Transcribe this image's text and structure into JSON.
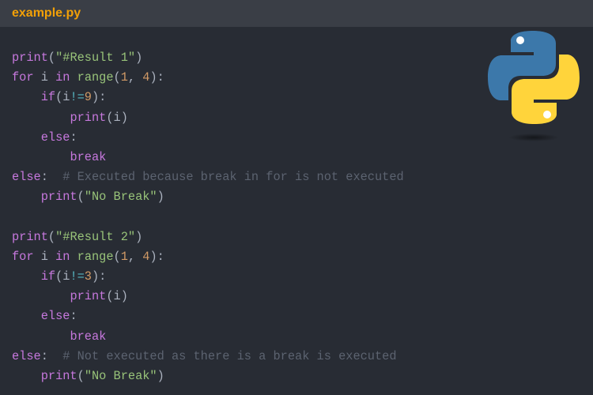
{
  "header": {
    "filename": "example.py"
  },
  "logo": {
    "name": "python-logo",
    "colors": {
      "blue": "#3c78aa",
      "yellow": "#ffd43b"
    }
  },
  "code": {
    "lines": [
      [
        [
          "fn",
          "print"
        ],
        [
          "p",
          "("
        ],
        [
          "str",
          "\"#Result 1\""
        ],
        [
          "p",
          ")"
        ]
      ],
      [
        [
          "kw",
          "for"
        ],
        [
          "p",
          " i "
        ],
        [
          "kw",
          "in"
        ],
        [
          "p",
          " "
        ],
        [
          "bi",
          "range"
        ],
        [
          "p",
          "("
        ],
        [
          "num",
          "1"
        ],
        [
          "p",
          ", "
        ],
        [
          "num",
          "4"
        ],
        [
          "p",
          "):"
        ]
      ],
      [
        [
          "p",
          "    "
        ],
        [
          "kw",
          "if"
        ],
        [
          "p",
          "(i"
        ],
        [
          "op",
          "!="
        ],
        [
          "num",
          "9"
        ],
        [
          "p",
          "):"
        ]
      ],
      [
        [
          "p",
          "        "
        ],
        [
          "fn",
          "print"
        ],
        [
          "p",
          "(i)"
        ]
      ],
      [
        [
          "p",
          "    "
        ],
        [
          "kw",
          "else"
        ],
        [
          "p",
          ":"
        ]
      ],
      [
        [
          "p",
          "        "
        ],
        [
          "kw",
          "break"
        ]
      ],
      [
        [
          "kw",
          "else"
        ],
        [
          "p",
          ":  "
        ],
        [
          "cm",
          "# Executed because break in for is not executed"
        ]
      ],
      [
        [
          "p",
          "    "
        ],
        [
          "fn",
          "print"
        ],
        [
          "p",
          "("
        ],
        [
          "str",
          "\"No Break\""
        ],
        [
          "p",
          ")"
        ]
      ],
      [],
      [
        [
          "fn",
          "print"
        ],
        [
          "p",
          "("
        ],
        [
          "str",
          "\"#Result 2\""
        ],
        [
          "p",
          ")"
        ]
      ],
      [
        [
          "kw",
          "for"
        ],
        [
          "p",
          " i "
        ],
        [
          "kw",
          "in"
        ],
        [
          "p",
          " "
        ],
        [
          "bi",
          "range"
        ],
        [
          "p",
          "("
        ],
        [
          "num",
          "1"
        ],
        [
          "p",
          ", "
        ],
        [
          "num",
          "4"
        ],
        [
          "p",
          "):"
        ]
      ],
      [
        [
          "p",
          "    "
        ],
        [
          "kw",
          "if"
        ],
        [
          "p",
          "(i"
        ],
        [
          "op",
          "!="
        ],
        [
          "num",
          "3"
        ],
        [
          "p",
          "):"
        ]
      ],
      [
        [
          "p",
          "        "
        ],
        [
          "fn",
          "print"
        ],
        [
          "p",
          "(i)"
        ]
      ],
      [
        [
          "p",
          "    "
        ],
        [
          "kw",
          "else"
        ],
        [
          "p",
          ":"
        ]
      ],
      [
        [
          "p",
          "        "
        ],
        [
          "kw",
          "break"
        ]
      ],
      [
        [
          "kw",
          "else"
        ],
        [
          "p",
          ":  "
        ],
        [
          "cm",
          "# Not executed as there is a break is executed"
        ]
      ],
      [
        [
          "p",
          "    "
        ],
        [
          "fn",
          "print"
        ],
        [
          "p",
          "("
        ],
        [
          "str",
          "\"No Break\""
        ],
        [
          "p",
          ")"
        ]
      ]
    ]
  }
}
